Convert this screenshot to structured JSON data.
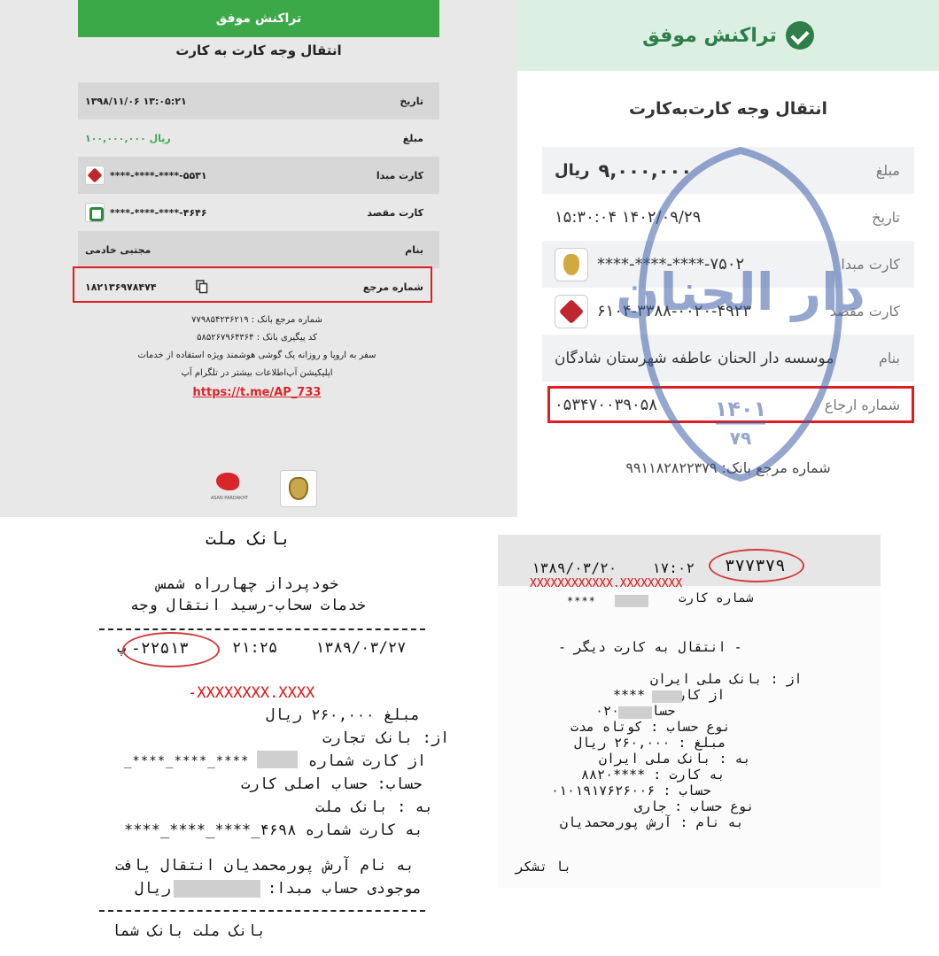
{
  "panel1": {
    "header": "تراکنش موفق",
    "title": "انتقال وجه کارت به کارت",
    "rows": [
      {
        "key": "تاریخ",
        "value": "۱۳۹۸/۱۱/۰۶  ۱۳:۰۵:۲۱"
      },
      {
        "key": "مبلغ",
        "value": "۱۰۰,۰۰۰,۰۰۰ ریال"
      },
      {
        "key": "کارت مبدا",
        "value": "****-****-****-۵۵۳۱"
      },
      {
        "key": "کارت مقصد",
        "value": "****-****-****-۴۶۴۶"
      },
      {
        "key": "بنام",
        "value": "مجتبی خادمی"
      },
      {
        "key": "شماره مرجع",
        "value": "۱۸۲۱۳۶۹۷۸۴۷۴"
      }
    ],
    "info_lines": [
      "شماره مرجع بانک : ۷۷۹۸۵۴۲۳۶۲۱۹",
      "کد پیگیری بانک : ۵۸۵۲۶۷۹۶۴۳۶۴",
      "سفر به اروپا و روزانه یک گوشی هوشمند ویژه استفاده از خدمات",
      "اپلیکیشن آپ‌اطلاعات بیشتر در تلگرام آپ"
    ],
    "link": "https://t.me/AP_733",
    "ap_caption": "ASAN PARDAKHT"
  },
  "panel2": {
    "header": "تراکنش موفق",
    "title": "انتقال وجه کارت‌به‌کارت",
    "rows": [
      {
        "key": "مبلغ",
        "value": "۹,۰۰۰,۰۰۰",
        "unit": "ریال"
      },
      {
        "key": "تاریخ",
        "value": "۱۵:۳۰:۰۴ ۱۴۰۲/۰۹/۲۹"
      },
      {
        "key": "کارت مبدا",
        "value": "****-****-****-۷۵۰۲"
      },
      {
        "key": "کارت مقصد",
        "value": "۶۱۰۴-۳۳۸۸-۰۰۲۰-۴۹۲۳"
      },
      {
        "key": "بنام",
        "value": "موسسه دار الحنان عاطفه شهرستان شادگان"
      },
      {
        "key": "شماره ارجاع",
        "value": "۰۵۳۴۷۰۰۳۹۰۵۸"
      }
    ],
    "bank_ref": "شماره مرجع بانک: ۹۹۱۱۸۲۸۲۲۳۷۹",
    "watermark_text": "دار الحنان",
    "watermark_year": "۱۴۰۱",
    "watermark_sub": "۷۹"
  },
  "panel3": {
    "bank": "بانک ملت",
    "line1": "خودپرداز چهارراه شمس",
    "line2": "خدمات سحاب-رسید انتقال وجه",
    "trace": "۲۲۵۱۳-",
    "prefix": "پ",
    "time": "۲۱:۲۵",
    "date": "۱۳۸۹/۰۳/۲۷",
    "struck": "-XXXXXXXX.XXXX",
    "amount": "مبلغ ۲۶۰,۰۰۰ ریال",
    "from_bank": "از: بانک تجارت",
    "from_card": "از کارت شماره",
    "card_mask": "****_****_****_",
    "account": "حساب: حساب اصلی کارت",
    "to_bank": "به : بانک ملت",
    "to_card": "به کارت شماره ۴۶۹۸_****_****_****",
    "transferred": "به نام آرش پورمحمدیان انتقال یافت",
    "balance": "موجودی حساب مبدا:",
    "balance_unit": "ریال",
    "footer": "بانک ملت   بانک شما"
  },
  "panel4": {
    "date": "۱۳۸۹/۰۳/۲۰",
    "time": "۱۷:۰۲",
    "trace": "۳۷۷۳۷۹",
    "struck": "XXXXXXXXXXXX.XXXXXXXXX",
    "card_label": "شماره کارت",
    "card_mask": "****",
    "transfer_title": "- انتقال به کارت دیگر -",
    "lines": [
      "از : بانک ملی ایران",
      "از کارت :       ****",
      "حساب :          ۰۲۰",
      "نوع حساب : کوتاه مدت",
      "مبلغ :  ۲۶۰,۰۰۰ ریال",
      "به : بانک ملی ایران",
      "به کارت :   ****۸۸۲۰",
      "حساب : ۰۱۰۱۹۱۷۶۲۶۰۰۶",
      "نوع حساب : جاری",
      "به نام : آرش پورمحمدیان"
    ],
    "thanks": "با تشکر"
  }
}
